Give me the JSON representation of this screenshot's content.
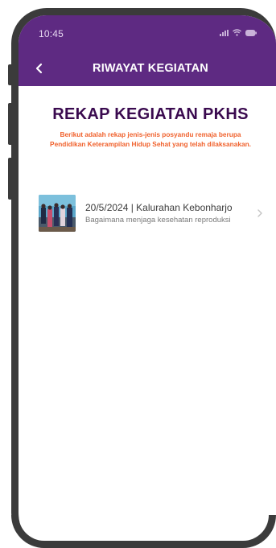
{
  "status_bar": {
    "time": "10:45"
  },
  "app_bar": {
    "title": "RIWAYAT KEGIATAN"
  },
  "page": {
    "title": "REKAP KEGIATAN PKHS",
    "subtitle": "Berikut adalah rekap jenis-jenis posyandu remaja berupa Pendidikan Keterampilan Hidup Sehat yang telah dilaksanakan."
  },
  "activities": [
    {
      "title": "20/5/2024 | Kalurahan Kebonharjo",
      "description": "Bagaimana menjaga kesehatan reproduksi"
    }
  ],
  "colors": {
    "header": "#5e2a82",
    "title": "#3a0a4f",
    "subtitle": "#f0612c"
  }
}
